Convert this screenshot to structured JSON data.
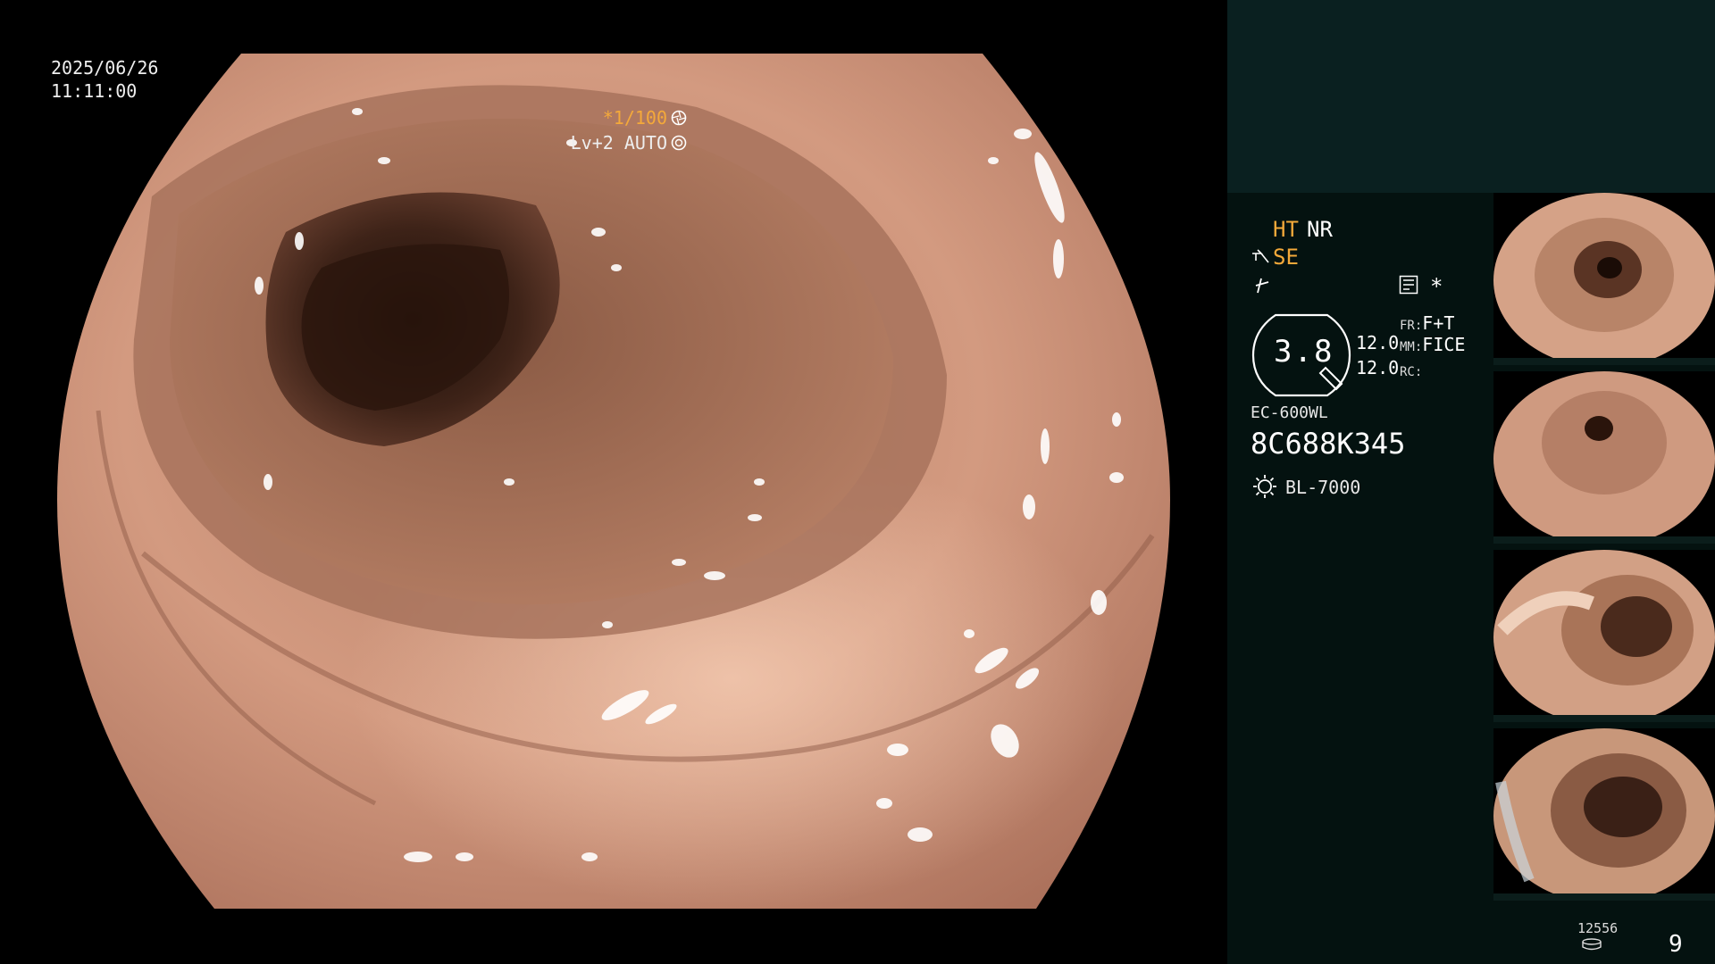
{
  "overlay": {
    "date": "2025/06/26",
    "time": "11:11:00",
    "shutter": "*1/100",
    "iris": "Lv+2 AUTO"
  },
  "settings": {
    "ht": "HT",
    "nr": "NR",
    "se": "SE",
    "asterisk": "*"
  },
  "zoom": {
    "value": "3.8",
    "line1": "12.0",
    "line2": "12.0"
  },
  "modes": {
    "fr_label": "FR:",
    "fr_value": "F+T",
    "mm_label": "MM:",
    "mm_value": "FICE",
    "rc_label": "RC:"
  },
  "scope": {
    "model": "EC-600WL",
    "serial": "8C688K345",
    "light_source": "BL-7000"
  },
  "footer": {
    "image_count": "12556",
    "page_number": "9"
  },
  "colors": {
    "accent": "#f4a93a",
    "panel": "#041210",
    "panel_top": "#0a2020"
  },
  "icons": [
    "shutter-icon",
    "iris-icon",
    "structure-enhance-icon",
    "hook-icon",
    "memo-icon",
    "lamp-icon",
    "storage-icon"
  ]
}
